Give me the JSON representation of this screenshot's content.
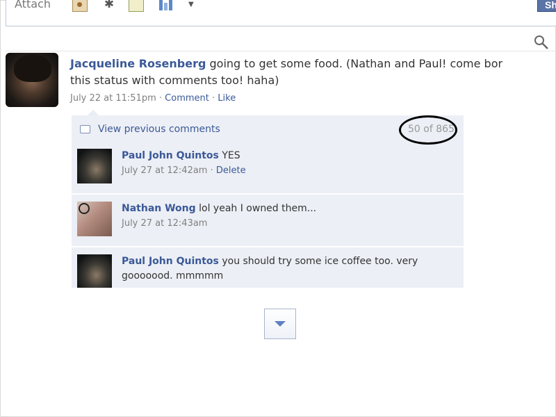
{
  "composer": {
    "attach_label": "Attach",
    "share_label": "Sh",
    "icons": [
      "photo-icon",
      "event-icon",
      "gift-icon",
      "poll-icon",
      "dropdown-arrow-icon"
    ]
  },
  "status": {
    "author": "Jacqueline Rosenberg",
    "text_line1": " going to get some food. (Nathan and Paul! come bor",
    "text_line2": "this status with comments too! haha)",
    "timestamp": "July 22 at 11:51pm",
    "comment_link": "Comment",
    "like_link": "Like",
    "separator": " · "
  },
  "comments_panel": {
    "view_previous_label": "View previous comments",
    "count_label": "50 of 865",
    "items": [
      {
        "name": "Paul John Quintos",
        "text": " YES",
        "timestamp": "July 27 at 12:42am",
        "action": "Delete"
      },
      {
        "name": "Nathan Wong",
        "text": " lol yeah I owned them...",
        "timestamp": "July 27 at 12:43am",
        "action": ""
      },
      {
        "name": "Paul John Quintos",
        "text": " you should try some ice coffee too. very gooooood. mmmmm",
        "timestamp": "",
        "action": ""
      }
    ]
  },
  "colors": {
    "link_blue": "#3b5998",
    "panel_bg": "#eceff5",
    "meta_gray": "#808080",
    "annotation_circle": "#000000"
  }
}
